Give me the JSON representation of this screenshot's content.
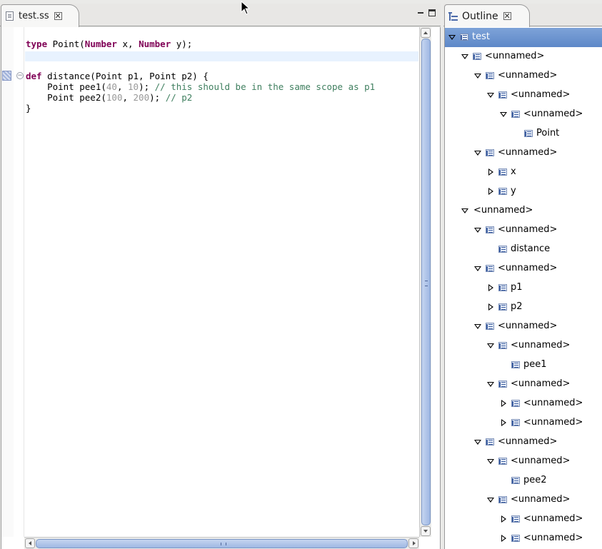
{
  "editor": {
    "tab_label": "test.ss",
    "code_lines": [
      {
        "parts": [
          {
            "t": "type",
            "c": "kw"
          },
          {
            "t": " Point(",
            "c": ""
          },
          {
            "t": "Number",
            "c": "kw"
          },
          {
            "t": " x, ",
            "c": ""
          },
          {
            "t": "Number",
            "c": "kw"
          },
          {
            "t": " y);",
            "c": ""
          }
        ]
      },
      {
        "parts": []
      },
      {
        "parts": []
      },
      {
        "parts": [
          {
            "t": "def",
            "c": "kw"
          },
          {
            "t": " distance(Point p1, Point p2) {",
            "c": ""
          }
        ]
      },
      {
        "parts": [
          {
            "t": "    Point pee1(",
            "c": ""
          },
          {
            "t": "40",
            "c": "num"
          },
          {
            "t": ", ",
            "c": ""
          },
          {
            "t": "10",
            "c": "num"
          },
          {
            "t": "); ",
            "c": ""
          },
          {
            "t": "// this should be in the same scope as p1",
            "c": "cmt"
          }
        ]
      },
      {
        "parts": [
          {
            "t": "    Point pee2(",
            "c": ""
          },
          {
            "t": "100",
            "c": "num"
          },
          {
            "t": ", ",
            "c": ""
          },
          {
            "t": "200",
            "c": "num"
          },
          {
            "t": "); ",
            "c": ""
          },
          {
            "t": "// p2",
            "c": "cmt"
          }
        ]
      },
      {
        "parts": [
          {
            "t": "}",
            "c": ""
          }
        ]
      }
    ]
  },
  "outline": {
    "tab_label": "Outline",
    "nodes": [
      {
        "label": "test",
        "depth": 0,
        "twisty": "open",
        "selected": true
      },
      {
        "label": "<unnamed>",
        "depth": 1,
        "twisty": "open"
      },
      {
        "label": "<unnamed>",
        "depth": 2,
        "twisty": "open"
      },
      {
        "label": "<unnamed>",
        "depth": 3,
        "twisty": "open"
      },
      {
        "label": "<unnamed>",
        "depth": 4,
        "twisty": "open"
      },
      {
        "label": "Point",
        "depth": 5,
        "twisty": "none"
      },
      {
        "label": "<unnamed>",
        "depth": 2,
        "twisty": "open"
      },
      {
        "label": "x",
        "depth": 3,
        "twisty": "closed"
      },
      {
        "label": "y",
        "depth": 3,
        "twisty": "closed"
      },
      {
        "label": "<unnamed>",
        "depth": 1,
        "twisty": "open",
        "noicon": true
      },
      {
        "label": "<unnamed>",
        "depth": 2,
        "twisty": "open"
      },
      {
        "label": "distance",
        "depth": 3,
        "twisty": "none"
      },
      {
        "label": "<unnamed>",
        "depth": 2,
        "twisty": "open"
      },
      {
        "label": "p1",
        "depth": 3,
        "twisty": "closed"
      },
      {
        "label": "p2",
        "depth": 3,
        "twisty": "closed"
      },
      {
        "label": "<unnamed>",
        "depth": 2,
        "twisty": "open"
      },
      {
        "label": "<unnamed>",
        "depth": 3,
        "twisty": "open"
      },
      {
        "label": "pee1",
        "depth": 4,
        "twisty": "none"
      },
      {
        "label": "<unnamed>",
        "depth": 3,
        "twisty": "open"
      },
      {
        "label": "<unnamed>",
        "depth": 4,
        "twisty": "closed"
      },
      {
        "label": "<unnamed>",
        "depth": 4,
        "twisty": "closed"
      },
      {
        "label": "<unnamed>",
        "depth": 2,
        "twisty": "open"
      },
      {
        "label": "<unnamed>",
        "depth": 3,
        "twisty": "open"
      },
      {
        "label": "pee2",
        "depth": 4,
        "twisty": "none"
      },
      {
        "label": "<unnamed>",
        "depth": 3,
        "twisty": "open"
      },
      {
        "label": "<unnamed>",
        "depth": 4,
        "twisty": "closed"
      },
      {
        "label": "<unnamed>",
        "depth": 4,
        "twisty": "closed"
      }
    ]
  },
  "icons": {
    "file": "file-icon",
    "outline": "outline-icon",
    "tree_node": "tree-node-icon",
    "close": "close-icon",
    "minimize": "minimize-icon",
    "maximize": "maximize-icon",
    "cursor": "cursor-icon"
  }
}
